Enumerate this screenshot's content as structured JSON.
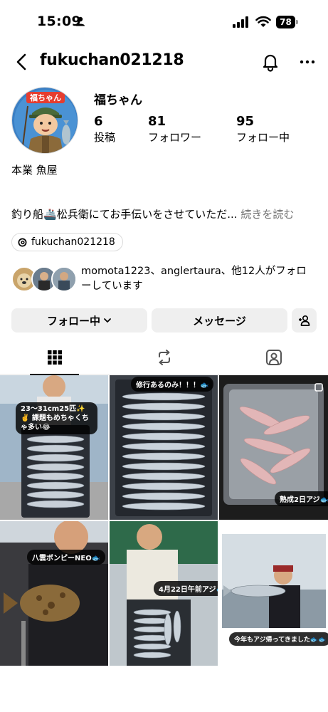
{
  "status_bar": {
    "time": "15:09",
    "battery": "78"
  },
  "header": {
    "username": "fukuchan021218"
  },
  "avatar": {
    "badge_text": "福ちゃん"
  },
  "profile": {
    "display_name": "福ちゃん",
    "stats": [
      {
        "value": "6",
        "label": "投稿"
      },
      {
        "value": "81",
        "label": "フォロワー"
      },
      {
        "value": "95",
        "label": "フォロー中"
      }
    ],
    "bio_line1": "本業 魚屋",
    "bio_line2_a": "釣り船",
    "bio_line2_b": "松兵衛にてお手伝いをさせていただ...",
    "bio_more": " 続きを読む",
    "threads_handle": "fukuchan021218"
  },
  "followed_by": {
    "text": "momota1223、anglertaura、他12人がフォローしています"
  },
  "actions": {
    "following_label": "フォロー中",
    "message_label": "メッセージ"
  },
  "tabs": [
    "posts",
    "reels",
    "tagged"
  ],
  "posts": [
    {
      "caption": "23〜31cm25匹✨✌️ 課題もめちゃくちゃ多い😂"
    },
    {
      "caption": "修行あるのみ！！！🐟"
    },
    {
      "caption": "熟成2日アジ🐟"
    },
    {
      "caption": "八雲ボンピーNEO🐟"
    },
    {
      "caption": "4月22日午前アジ🐟"
    },
    {
      "caption": "今年もアジ帰ってきました🐟🐟"
    }
  ],
  "colors": {
    "muted": "#737373",
    "button_bg": "#efefef",
    "border": "#dbdbdb"
  }
}
